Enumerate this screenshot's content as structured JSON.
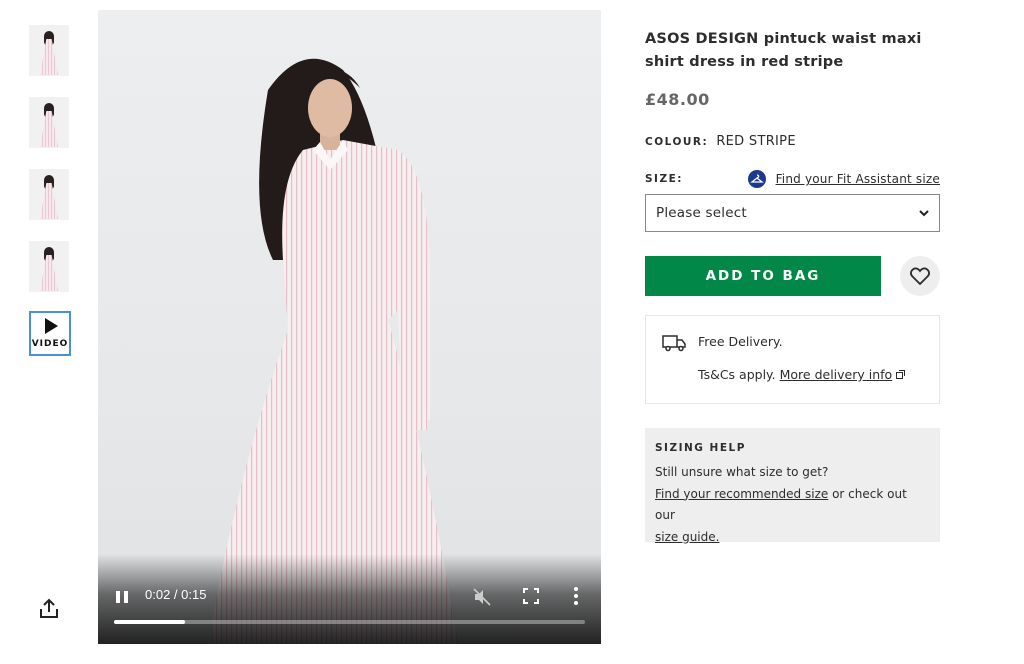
{
  "thumbnails": [
    {
      "name": "thumbnail-1"
    },
    {
      "name": "thumbnail-2"
    },
    {
      "name": "thumbnail-3"
    },
    {
      "name": "thumbnail-4"
    }
  ],
  "video_thumb": {
    "label": "VIDEO",
    "icon": "play-icon"
  },
  "share": {
    "icon": "share-icon"
  },
  "player": {
    "time": "0:02 / 0:15",
    "progress": 0.15,
    "icons": [
      "pause-icon",
      "mute-icon",
      "fullscreen-icon",
      "more-options-icon"
    ]
  },
  "product": {
    "title_line1": "ASOS DESIGN pintuck waist maxi",
    "title_line2": "shirt dress in red stripe",
    "price": "£48.00"
  },
  "colour": {
    "label": "COLOUR:",
    "value": "RED STRIPE"
  },
  "size": {
    "label": "SIZE:",
    "fit_link": "Find your Fit Assistant size",
    "select_value": "Please select"
  },
  "actions": {
    "add_to_bag": "ADD TO BAG",
    "wishlist_icon": "heart-icon"
  },
  "delivery": {
    "title": "Free Delivery.",
    "terms": "Ts&Cs apply.",
    "more_link": "More delivery info"
  },
  "sizing_help": {
    "heading": "SIZING HELP",
    "line1": "Still unsure what size to get?",
    "link1": "Find your recommended size",
    "mid": " or check out our",
    "link2": "size guide."
  },
  "colors": {
    "accent_green": "#018849",
    "video_border": "#4b8fd6"
  }
}
